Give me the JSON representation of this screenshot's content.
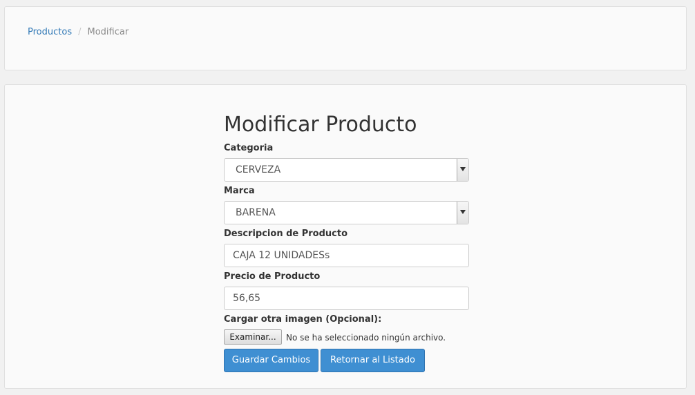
{
  "breadcrumb": {
    "items": [
      {
        "label": "Productos"
      },
      {
        "label": "Modificar"
      }
    ],
    "separator": "/"
  },
  "form": {
    "title": "Modificar Producto",
    "categoria": {
      "label": "Categoria",
      "value": "CERVEZA"
    },
    "marca": {
      "label": "Marca",
      "value": "BARENA"
    },
    "descripcion": {
      "label": "Descripcion de Producto",
      "value": "CAJA 12 UNIDADESs"
    },
    "precio": {
      "label": "Precio de Producto",
      "value": "56,65"
    },
    "imagen": {
      "label": "Cargar otra imagen (Opcional):",
      "button_label": "Examinar...",
      "status": "No se ha seleccionado ningún archivo."
    },
    "buttons": {
      "save": "Guardar Cambios",
      "back": "Retornar al Listado"
    }
  },
  "colors": {
    "primary_button": "#3f8fd2",
    "link": "#337ab7",
    "panel_background": "#fafafa",
    "page_background": "#f1f1f1"
  },
  "icons": {
    "select_arrow": "chevron-down-icon"
  }
}
